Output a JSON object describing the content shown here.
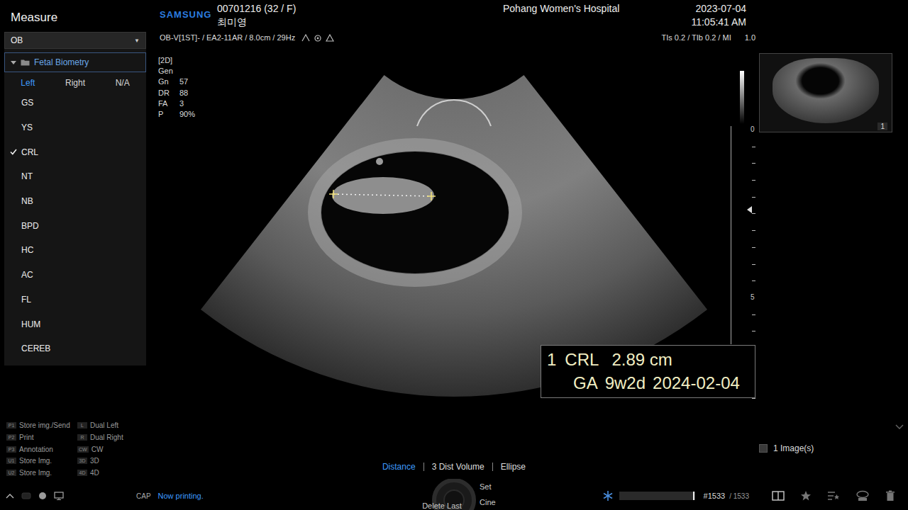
{
  "sidebar": {
    "title": "Measure",
    "dropdown": {
      "value": "OB",
      "arrow": "▼"
    },
    "folder": {
      "label": "Fetal Biometry",
      "expanded": true
    },
    "tabs": [
      {
        "label": "Left",
        "selected": true
      },
      {
        "label": "Right",
        "selected": false
      },
      {
        "label": "N/A",
        "selected": false
      }
    ],
    "items": [
      {
        "label": "GS",
        "checked": false
      },
      {
        "label": "YS",
        "checked": false
      },
      {
        "label": "CRL",
        "checked": true
      },
      {
        "label": "NT",
        "checked": false
      },
      {
        "label": "NB",
        "checked": false
      },
      {
        "label": "BPD",
        "checked": false
      },
      {
        "label": "HC",
        "checked": false
      },
      {
        "label": "AC",
        "checked": false
      },
      {
        "label": "FL",
        "checked": false
      },
      {
        "label": "HUM",
        "checked": false
      },
      {
        "label": "CEREB",
        "checked": false
      }
    ]
  },
  "shortcuts": [
    {
      "key": "P1",
      "label": "Store img./Send"
    },
    {
      "key": "P2",
      "label": "Print"
    },
    {
      "key": "P3",
      "label": "Annotation"
    },
    {
      "key": "U1",
      "label": "Store Img."
    },
    {
      "key": "U2",
      "label": "Store Img."
    },
    {
      "key": "L",
      "label": "Dual Left"
    },
    {
      "key": "R",
      "label": "Dual Right"
    },
    {
      "key": "CW",
      "label": "CW"
    },
    {
      "key": "3D",
      "label": "3D"
    },
    {
      "key": "4D",
      "label": "4D"
    }
  ],
  "header": {
    "brand": "SAMSUNG",
    "patient_id": "00701216 (32 / F)",
    "patient_name": "최미영",
    "hospital": "Pohang Women's Hospital",
    "date": "2023-07-04",
    "time": "11:05:41 AM",
    "probe": "OB-V[1ST]- / EA2-11AR / 8.0cm / 29Hz",
    "indices": "TIs 0.2 / TIb 0.2 / MI",
    "mi": "1.0"
  },
  "image_params": {
    "mode": "[2D]",
    "preset": "Gen",
    "values": [
      {
        "label": "Gn",
        "value": "57"
      },
      {
        "label": "DR",
        "value": "88"
      },
      {
        "label": "FA",
        "value": "3"
      },
      {
        "label": "P",
        "value": "90%"
      }
    ]
  },
  "depth_scale": {
    "labels": [
      "0",
      "5"
    ]
  },
  "measurement": {
    "index": "1",
    "name": "CRL",
    "value": "2.89 cm",
    "ga_label": "GA",
    "ga": "9w2d",
    "edd": "2024-02-04"
  },
  "thumbnails": [
    {
      "index": "1",
      "selected": true
    }
  ],
  "image_count": {
    "label": "1 Image(s)",
    "checked": false
  },
  "tools": [
    {
      "label": "Distance",
      "selected": true
    },
    {
      "label": "3 Dist Volume",
      "selected": false
    },
    {
      "label": "Ellipse",
      "selected": false
    }
  ],
  "dial": {
    "set_left": "Set",
    "set_right": "Set",
    "delete_last": "Delete Last",
    "cine": "Cine"
  },
  "status": {
    "cap": "CAP",
    "message": "Now printing.",
    "frame": "#1533",
    "frame_total": "/ 1533",
    "cine_level": 0.98
  }
}
